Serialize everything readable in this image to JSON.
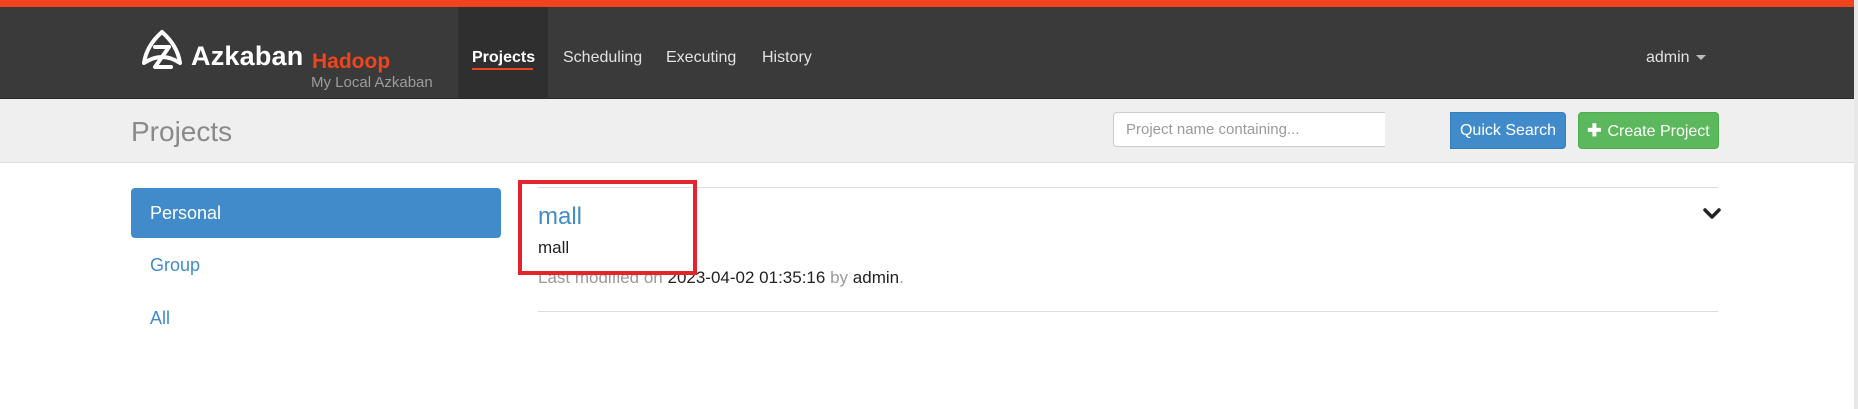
{
  "app": {
    "brand": "Azkaban",
    "brand_sub": "Hadoop",
    "brand_description": "My Local Azkaban"
  },
  "nav": {
    "items": [
      {
        "label": "Projects",
        "active": true
      },
      {
        "label": "Scheduling"
      },
      {
        "label": "Executing"
      },
      {
        "label": "History"
      }
    ],
    "user": "admin"
  },
  "header": {
    "title": "Projects",
    "search_placeholder": "Project name containing...",
    "quick_search_label": "Quick Search",
    "create_project_label": "Create Project"
  },
  "sidebar": {
    "items": [
      {
        "label": "Personal",
        "active": true
      },
      {
        "label": "Group"
      },
      {
        "label": "All"
      }
    ]
  },
  "projects": [
    {
      "name": "mall",
      "description": "mall",
      "modified_prefix": "Last modified on",
      "modified_date": "2023-04-02 01:35:16",
      "by_text": "by",
      "modified_by": "admin",
      "suffix": "."
    }
  ],
  "colors": {
    "accent": "#f0441c",
    "primary": "#428bca",
    "success": "#5cb85c",
    "navbar": "#3a3a3a",
    "annotation": "#e3242b"
  },
  "icons": {
    "logo": "azkaban-logo-icon",
    "plus": "plus-icon",
    "expand": "chevron-down-icon",
    "user_caret": "caret-down-icon"
  }
}
